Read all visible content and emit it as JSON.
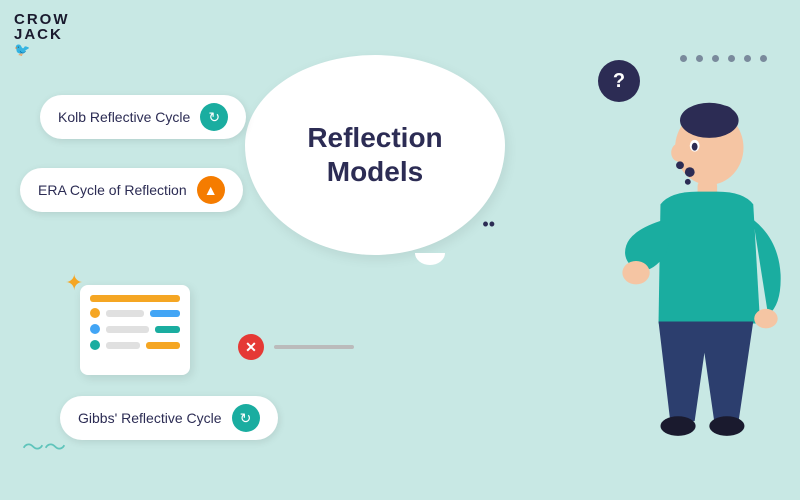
{
  "logo": {
    "line1": "CROW",
    "line2": "JACK"
  },
  "bubble": {
    "title_line1": "Reflection",
    "title_line2": "Models"
  },
  "pills": [
    {
      "id": "kolb",
      "label": "Kolb Reflective Cycle",
      "icon": "↻",
      "icon_style": "teal"
    },
    {
      "id": "era",
      "label": "ERA Cycle of Reflection",
      "icon": "▲",
      "icon_style": "orange"
    },
    {
      "id": "gibbs",
      "label": "Gibbs' Reflective Cycle",
      "icon": "↻",
      "icon_style": "teal"
    }
  ],
  "question_mark": "?",
  "sparkle": "✦",
  "wave": "〜〜",
  "colors": {
    "bg": "#c8e8e4",
    "dark": "#2c2c54",
    "teal": "#1aada0",
    "orange": "#f57c00",
    "white": "#ffffff"
  }
}
